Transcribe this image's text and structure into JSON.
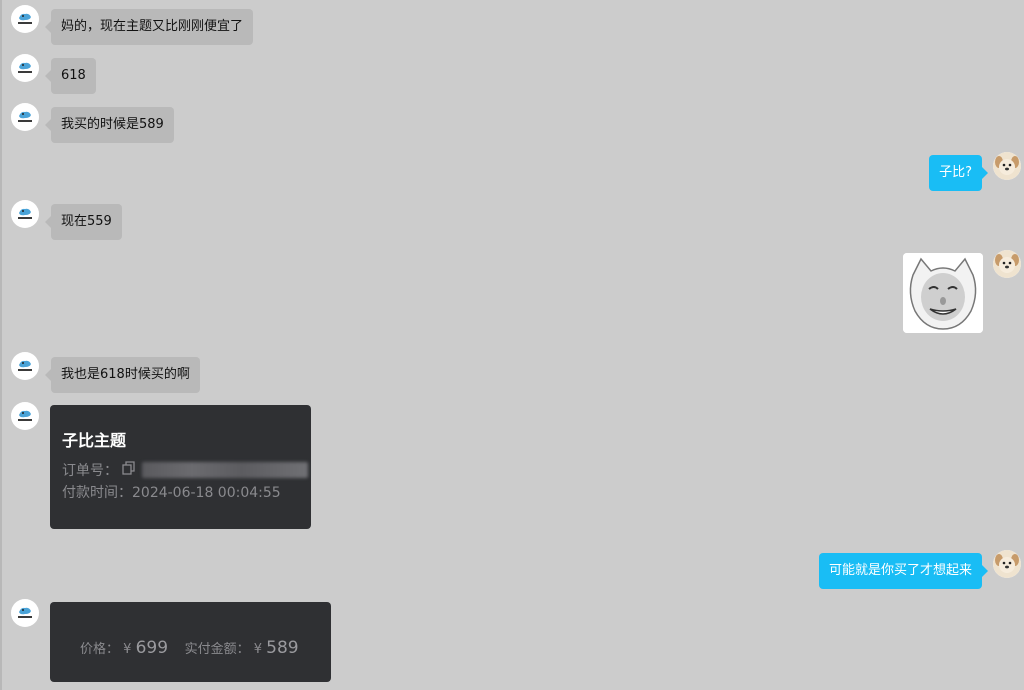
{
  "messages": {
    "m1": "妈的，现在主题又比刚刚便宜了",
    "m2": "618",
    "m3": "我买的时候是589",
    "m4": "子比?",
    "m5": "现在559",
    "m6": "我也是618时候买的啊",
    "m7": "可能就是你买了才想起来"
  },
  "order_card": {
    "title": "子比主题",
    "order_label": "订单号：",
    "pay_time_label": "付款时间：",
    "pay_time": "2024-06-18 00:04:55"
  },
  "price_card": {
    "price_label": "价格：",
    "currency": "¥",
    "price": "699",
    "paid_label": "实付金额：",
    "paid": "589"
  },
  "colors": {
    "background": "#cccccc",
    "left_bubble": "#b9b9b9",
    "right_bubble": "#19bdf5",
    "card": "#2f3033"
  },
  "icons": {
    "other_avatar": "cartoon-logo-avatar",
    "self_avatar": "puppy-avatar",
    "copy": "copy-icon",
    "sticker": "meme-face-sticker"
  }
}
